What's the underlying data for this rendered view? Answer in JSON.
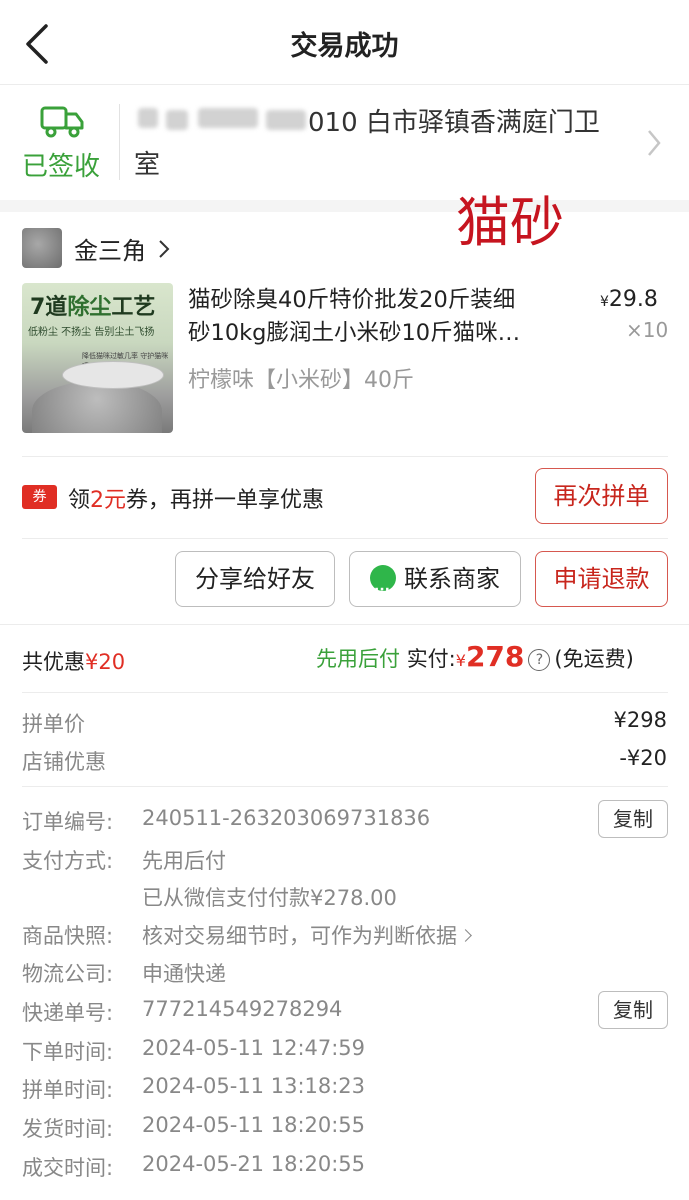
{
  "header": {
    "title": "交易成功"
  },
  "delivery": {
    "status": "已签收",
    "address_line1": "010 白市驿镇香满庭门卫",
    "address_line2": "室"
  },
  "overlay_label": "猫砂",
  "shop": {
    "name": "金三角"
  },
  "product": {
    "title_line1": "猫砂除臭40斤特价批发20斤装细",
    "title_line2": "砂10kg膨润土小米砂10斤猫咪…",
    "price_symbol": "¥",
    "price": "29.8",
    "qty": "×10",
    "spec": "柠檬味【小米砂】40斤",
    "image_text": {
      "t1a": "7道",
      "t1b": "除尘",
      "t1c": "工艺",
      "t2": "低粉尘 不扬尘 告别尘土飞扬",
      "t3": "降低猫咪过敏几率 守护猫咪呼吸系统"
    }
  },
  "coupon": {
    "badge": "券",
    "text_pre": "领",
    "text_amount": "2元",
    "text_post": "券，再拼一单享优惠",
    "button": "再次拼单"
  },
  "actions": {
    "share": "分享给好友",
    "contact": "联系商家",
    "refund": "申请退款"
  },
  "summary": {
    "discount_label": "共优惠",
    "discount_value": "¥20",
    "paylater": "先用后付",
    "paid_label": "实付:",
    "paid_symbol": "¥",
    "paid_value": "278",
    "shipping": "(免运费)"
  },
  "breakdown": [
    {
      "label": "拼单价",
      "value": "¥298"
    },
    {
      "label": "店铺优惠",
      "value": "-¥20"
    }
  ],
  "details": {
    "order_no_label": "订单编号:",
    "order_no": "240511-263203069731836",
    "copy": "复制",
    "pay_label": "支付方式:",
    "pay_value": "先用后付",
    "pay_note": "已从微信支付付款¥278.00",
    "snapshot_label": "商品快照:",
    "snapshot_value": "核对交易细节时，可作为判断依据",
    "courier_label": "物流公司:",
    "courier_value": "申通快递",
    "tracking_label": "快递单号:",
    "tracking_value": "777214549278294",
    "times": [
      {
        "label": "下单时间:",
        "value": "2024-05-11 12:47:59"
      },
      {
        "label": "拼单时间:",
        "value": "2024-05-11 13:18:23"
      },
      {
        "label": "发货时间:",
        "value": "2024-05-11 18:20:55"
      },
      {
        "label": "成交时间:",
        "value": "2024-05-21 18:20:55"
      }
    ]
  },
  "colors": {
    "accent_red": "#e02e24",
    "success_green": "#3aa13a"
  }
}
